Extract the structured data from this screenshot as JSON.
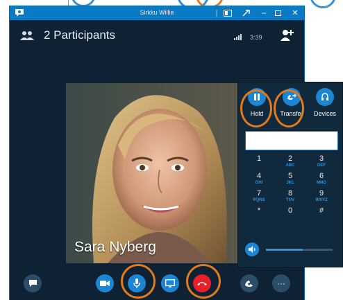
{
  "window": {
    "title": "Sirkku Willie"
  },
  "header": {
    "participants_label": "2 Participants",
    "call_duration": "3:39"
  },
  "video": {
    "person_name": "Sara Nyberg"
  },
  "dialpad": {
    "hold_label": "Hold",
    "transfer_label": "Transfer",
    "devices_label": "Devices",
    "keys": [
      {
        "digit": "1",
        "letters": ""
      },
      {
        "digit": "2",
        "letters": "ABC"
      },
      {
        "digit": "3",
        "letters": "DEF"
      },
      {
        "digit": "4",
        "letters": "GHI"
      },
      {
        "digit": "5",
        "letters": "JKL"
      },
      {
        "digit": "6",
        "letters": "MNO"
      },
      {
        "digit": "7",
        "letters": "PQRS"
      },
      {
        "digit": "8",
        "letters": "TUV"
      },
      {
        "digit": "9",
        "letters": "WXYZ"
      },
      {
        "digit": "*",
        "letters": ""
      },
      {
        "digit": "0",
        "letters": ""
      },
      {
        "digit": "#",
        "letters": ""
      }
    ],
    "volume_level": 0.55
  },
  "colors": {
    "window_bg": "#0e2233",
    "titlebar": "#0b7ac4",
    "accent_blue": "#1d86d4",
    "hangup_red": "#e8202a",
    "annotation_orange": "#e07a1c"
  }
}
